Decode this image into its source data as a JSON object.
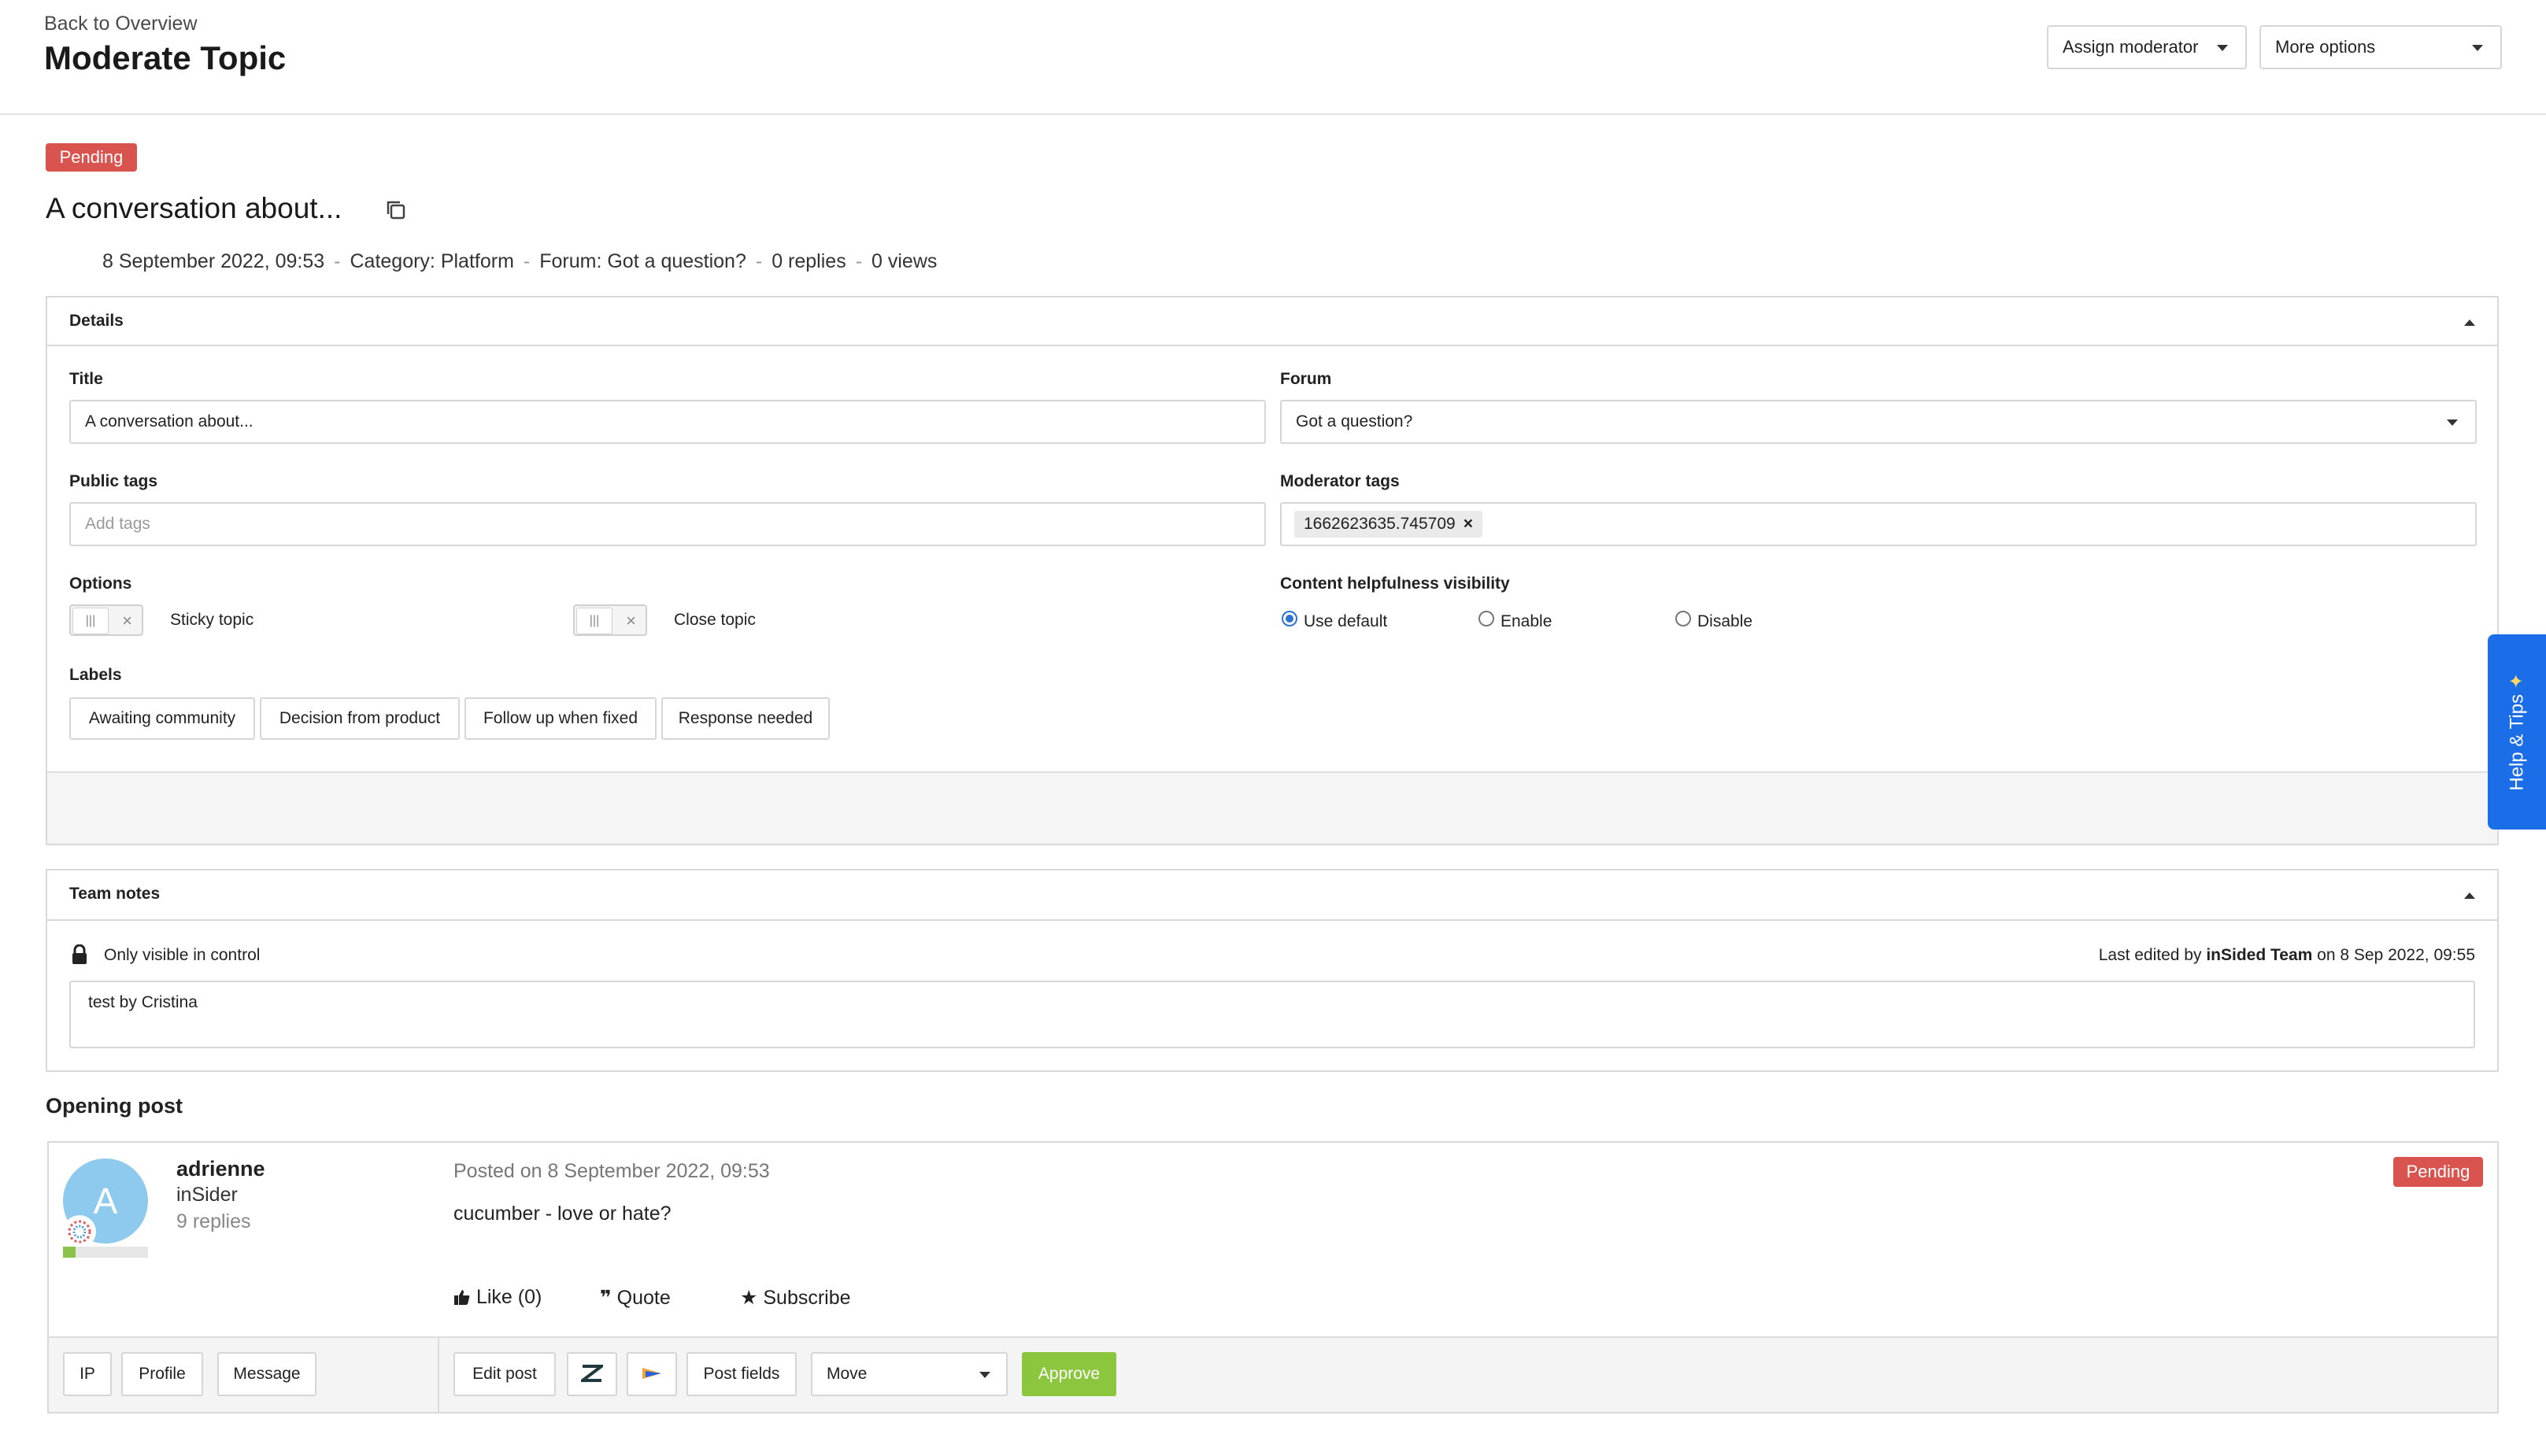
{
  "header": {
    "back_link": "Back to Overview",
    "title": "Moderate Topic",
    "assign_moderator": "Assign moderator",
    "more_options": "More options"
  },
  "topic": {
    "status": "Pending",
    "title": "A conversation about...",
    "meta": {
      "date": "8 September 2022, 09:53",
      "category": "Category: Platform",
      "forum": "Forum: Got a question?",
      "replies": "0 replies",
      "views": "0 views"
    }
  },
  "details": {
    "heading": "Details",
    "title_label": "Title",
    "title_value": "A conversation about...",
    "forum_label": "Forum",
    "forum_value": "Got a question?",
    "public_tags_label": "Public tags",
    "public_tags_placeholder": "Add tags",
    "moderator_tags_label": "Moderator tags",
    "moderator_tag": "1662623635.745709",
    "options_label": "Options",
    "sticky_topic": "Sticky topic",
    "close_topic": "Close topic",
    "helpfulness_label": "Content helpfulness visibility",
    "helpfulness_options": [
      "Use default",
      "Enable",
      "Disable"
    ],
    "helpfulness_selected": "Use default",
    "labels_label": "Labels",
    "labels": [
      "Awaiting community",
      "Decision from product",
      "Follow up when fixed",
      "Response needed"
    ]
  },
  "team_notes": {
    "heading": "Team notes",
    "visibility": "Only visible in control",
    "last_edited_prefix": "Last edited by",
    "last_edited_by": "inSided Team",
    "last_edited_on": "on 8 Sep 2022, 09:55",
    "note": "test by Cristina"
  },
  "opening_post": {
    "heading": "Opening post",
    "author": {
      "initial": "A",
      "name": "adrienne",
      "role": "inSider",
      "replies": "9 replies"
    },
    "posted": "Posted on 8 September 2022, 09:53",
    "status": "Pending",
    "body": "cucumber - love or hate?",
    "actions": {
      "like": "Like (0)",
      "quote": "Quote",
      "subscribe": "Subscribe"
    },
    "footer": {
      "ip": "IP",
      "profile": "Profile",
      "message": "Message",
      "edit_post": "Edit post",
      "post_fields": "Post fields",
      "move": "Move",
      "approve": "Approve"
    }
  },
  "help_tab": "Help & Tips",
  "colors": {
    "pending": "#d9534f",
    "approve": "#8cc63f",
    "help_tab": "#1b6ee8",
    "radio_selected": "#2c73d2"
  }
}
